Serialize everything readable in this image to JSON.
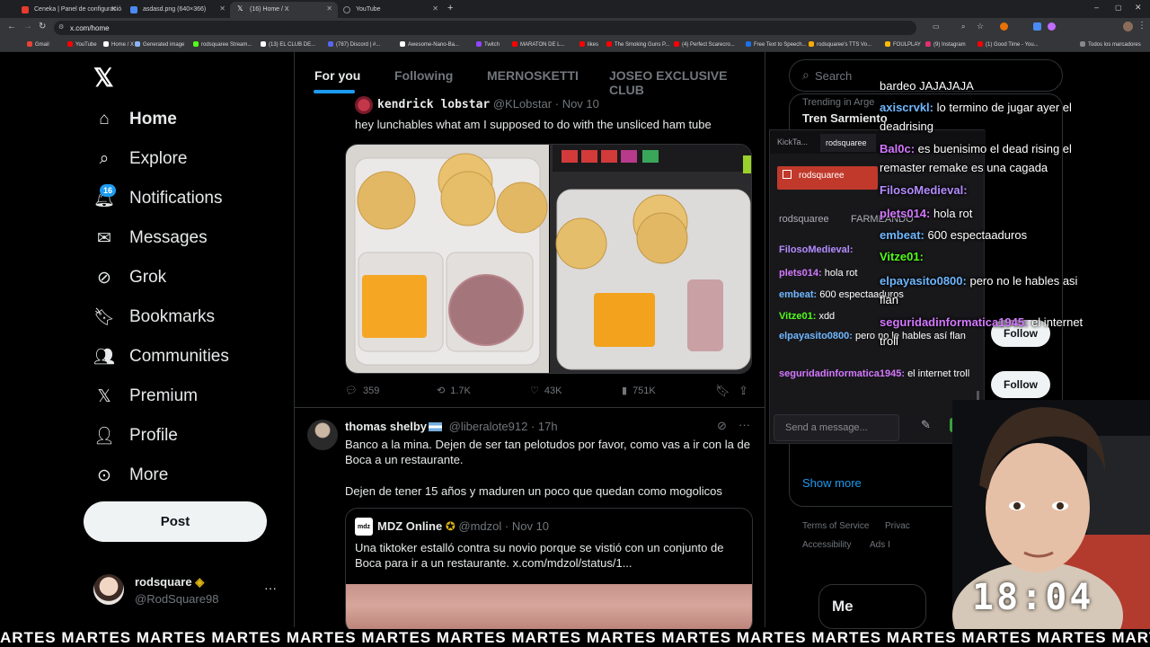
{
  "browser": {
    "tabs": [
      {
        "title": "Ceneka | Panel de configuració",
        "color": "#e63b2e"
      },
      {
        "title": "asdasd.png (640×366)",
        "color": "#4a8af4"
      },
      {
        "title": "(16) Home / X",
        "color": "#ffffff"
      },
      {
        "title": "YouTube",
        "color": "#888888"
      }
    ],
    "url": "x.com/home",
    "bookmarks": [
      {
        "label": "Gmail",
        "color": "#ea4335"
      },
      {
        "label": "YouTube",
        "color": "#ff0000"
      },
      {
        "label": "Home / X",
        "color": "#ffffff"
      },
      {
        "label": "Generated image",
        "color": "#8ab4f8"
      },
      {
        "label": "rodsquaree Stream...",
        "color": "#53fc18"
      },
      {
        "label": "(13) EL CLUB DE...",
        "color": "#ffffff"
      },
      {
        "label": "(787) Discord | #...",
        "color": "#5865f2"
      },
      {
        "label": "Awesome-Nano-Ba...",
        "color": "#ffffff"
      },
      {
        "label": "Twitch",
        "color": "#9146ff"
      },
      {
        "label": "MARATON DE L...",
        "color": "#ff0000"
      },
      {
        "label": "likes",
        "color": "#ff0000"
      },
      {
        "label": "The Smoking Guns P...",
        "color": "#ff0000"
      },
      {
        "label": "(4) Perfect Scarecro...",
        "color": "#ff0000"
      },
      {
        "label": "Free Text to Speech...",
        "color": "#1a73e8"
      },
      {
        "label": "rodsquaree's TTS Vo...",
        "color": "#f9ab00"
      },
      {
        "label": "FOULPLAY",
        "color": "#fbbc04"
      },
      {
        "label": "(9) Instagram",
        "color": "#e1306c"
      },
      {
        "label": "(1) Good Time - You...",
        "color": "#ff0000"
      }
    ],
    "all_bookmarks": "Todos los marcadores"
  },
  "sidebar": {
    "items": [
      {
        "label": "Home",
        "icon": "home-icon"
      },
      {
        "label": "Explore",
        "icon": "search-icon"
      },
      {
        "label": "Notifications",
        "icon": "bell-icon"
      },
      {
        "label": "Messages",
        "icon": "envelope-icon"
      },
      {
        "label": "Grok",
        "icon": "grok-icon"
      },
      {
        "label": "Bookmarks",
        "icon": "bookmark-icon"
      },
      {
        "label": "Communities",
        "icon": "people-icon"
      },
      {
        "label": "Premium",
        "icon": "x-logo-icon"
      },
      {
        "label": "Profile",
        "icon": "person-icon"
      },
      {
        "label": "More",
        "icon": "more-circle-icon"
      }
    ],
    "notification_count": "16",
    "post_label": "Post",
    "account": {
      "name": "rodsquare",
      "handle": "@RodSquare98"
    }
  },
  "feed": {
    "tabs": [
      "For you",
      "Following",
      "MERNOSKETTI",
      "JOSEO EXCLUSIVE CLUB"
    ],
    "tweets": [
      {
        "name": "kendrick lobstar",
        "handle": "@KLobstar",
        "time": "Nov 10",
        "text": "hey lunchables what am I supposed to do with the unsliced ham tube",
        "replies": "359",
        "reposts": "1.7K",
        "likes": "43K",
        "views": "751K"
      },
      {
        "name": "thomas shelby",
        "handle": "@liberalote912",
        "time": "17h",
        "text1": "Banco a la mina. Dejen de ser tan pelotudos por favor, como vas a ir con la de Boca a un restaurante.",
        "text2": "Dejen de tener 15 años y maduren un poco que quedan como mogolicos",
        "quote": {
          "name": "MDZ Online",
          "handle": "@mdzol",
          "time": "Nov 10",
          "text": "Una tiktoker estalló contra su novio porque se vistió con un conjunto de Boca para ir a un restaurante.  x.com/mdzol/status/1..."
        }
      }
    ]
  },
  "right": {
    "search_placeholder": "Search",
    "trending_label": "Trending in Arge",
    "trending_topic": "Tren Sarmiento",
    "show_more": "Show more",
    "follow_label": "Follow",
    "footer": [
      "Terms of Service",
      "Privac",
      "Accessibility",
      "Ads I"
    ]
  },
  "chat_popout": {
    "tabs": [
      "KickTa...",
      "rodsquaree"
    ],
    "channel": "rodsquaree",
    "header_user": "rodsquaree",
    "header_game": "FARMEANDO",
    "messages": [
      {
        "user": "FilosoMedieval:",
        "text": "",
        "color": "#b48cff"
      },
      {
        "user": "plets014:",
        "text": "hola rot",
        "color": "#d478ff"
      },
      {
        "user": "embeat:",
        "text": "600 espectaaduros",
        "color": "#6fb7ff"
      },
      {
        "user": "Vitze01:",
        "text": "xdd",
        "color": "#53fc18"
      },
      {
        "user": "elpayasito0800:",
        "text": "pero no le hables así flan",
        "color": "#6fb7ff"
      },
      {
        "user": "seguridadinformatica1945:",
        "text": "el internet troll",
        "color": "#d478ff"
      }
    ],
    "placeholder": "Send a message..."
  },
  "stream_chat": [
    {
      "user": "",
      "text": "bardeo JAJAJAJA",
      "color": "#ffffff"
    },
    {
      "user": "axiscrvkl:",
      "text": "lo termino de jugar ayer el deadrising",
      "color": "#6fb7ff"
    },
    {
      "user": "Bal0c:",
      "text": "es buenisimo el dead rising el remaster remake es una cagada",
      "color": "#d478ff"
    },
    {
      "user": "FilosoMedieval:",
      "text": "",
      "color": "#b48cff"
    },
    {
      "user": "plets014:",
      "text": "hola rot",
      "color": "#d478ff"
    },
    {
      "user": "embeat:",
      "text": "600 espectaaduros",
      "color": "#6fb7ff"
    },
    {
      "user": "Vitze01:",
      "text": "",
      "color": "#53fc18"
    },
    {
      "user": "elpayasito0800:",
      "text": "pero no le hables asi flan",
      "color": "#6fb7ff"
    },
    {
      "user": "seguridadinformatica1945:",
      "text": "el internet troll",
      "color": "#d478ff"
    }
  ],
  "overlay": {
    "clock": "18:04",
    "ticker": "ARTES  MARTES  MARTES  MARTES  MARTES  MARTES  MARTES  MARTES  MARTES  MARTES  MARTES  MARTES  MARTES  MARTES  MARTES  MARTES  MAR"
  }
}
